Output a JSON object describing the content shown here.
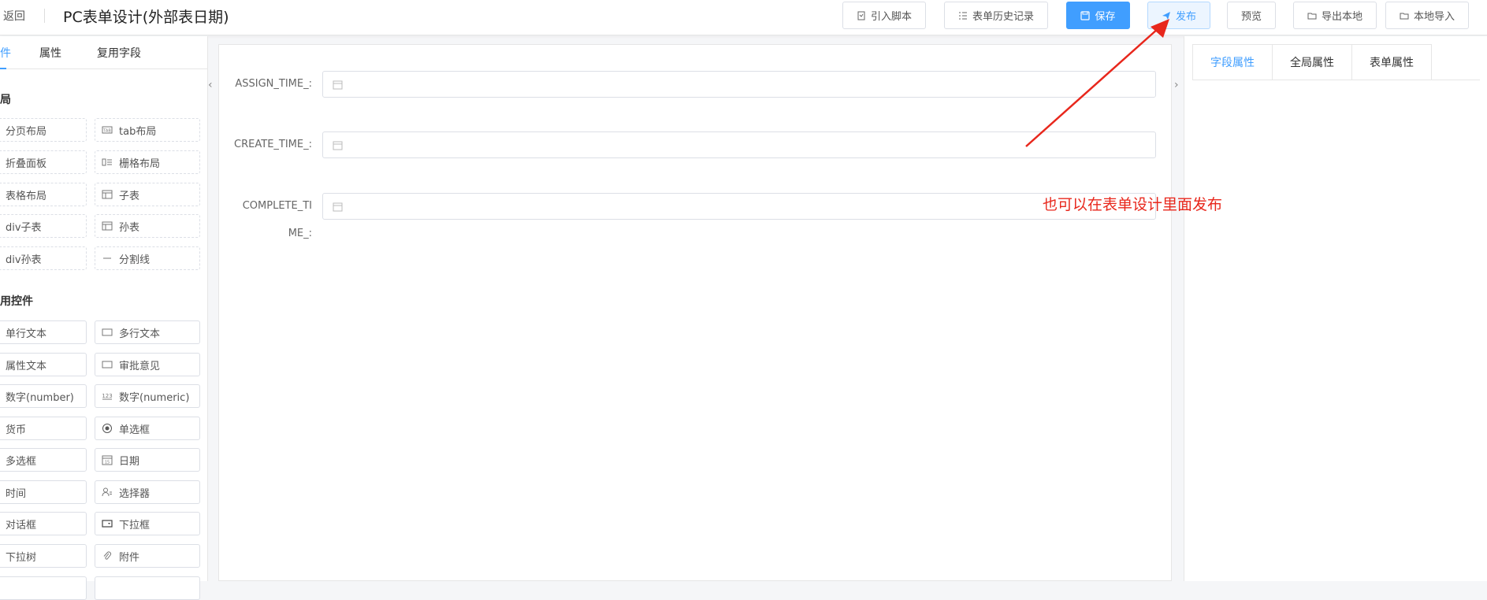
{
  "header": {
    "back_label": "返回",
    "title": "PC表单设计(外部表日期)",
    "buttons": {
      "import_script": "引入脚本",
      "history": "表单历史记录",
      "save": "保存",
      "publish": "发布",
      "preview": "预览",
      "export_local": "导出本地",
      "import_local": "本地导入"
    }
  },
  "left_panel": {
    "tabs": [
      "件",
      "属性",
      "复用字段"
    ],
    "layout_section": "局",
    "layout_items": [
      "分页布局",
      "tab布局",
      "折叠面板",
      "栅格布局",
      "表格布局",
      "子表",
      "div子表",
      "孙表",
      "div孙表",
      "分割线"
    ],
    "common_section": "用控件",
    "common_items": [
      "单行文本",
      "多行文本",
      "属性文本",
      "审批意见",
      "数字(number)",
      "数字(numeric)",
      "货币",
      "单选框",
      "多选框",
      "日期",
      "时间",
      "选择器",
      "对话框",
      "下拉框",
      "下拉树",
      "附件"
    ]
  },
  "form": {
    "fields": [
      {
        "label": "ASSIGN_TIME_:"
      },
      {
        "label": "CREATE_TIME_:"
      },
      {
        "label_line1": "COMPLETE_TI",
        "label_line2": "ME_:"
      }
    ]
  },
  "right_panel": {
    "tabs": [
      "字段属性",
      "全局属性",
      "表单属性"
    ]
  },
  "annotation": {
    "text": "也可以在表单设计里面发布",
    "color": "#e8271c"
  },
  "colors": {
    "primary": "#409eff"
  }
}
